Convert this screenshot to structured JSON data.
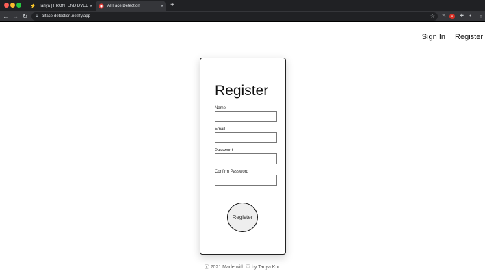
{
  "browser": {
    "tabs": [
      {
        "title": "Tanya | FRONTEND DVELOPER",
        "icon": "bolt-icon",
        "active": false
      },
      {
        "title": "AI Face Detection",
        "icon": "face-detect-icon",
        "active": true
      }
    ],
    "url": "aiface-detection.netlify.app"
  },
  "nav": {
    "sign_in": "Sign In",
    "register": "Register"
  },
  "form": {
    "title": "Register",
    "fields": [
      {
        "label": "Name",
        "value": ""
      },
      {
        "label": "Email",
        "value": ""
      },
      {
        "label": "Password",
        "value": ""
      },
      {
        "label": "Confirm Password",
        "value": ""
      }
    ],
    "submit_label": "Register"
  },
  "footer": {
    "text": "ⓒ 2021 Made with ♡ by Tanya Kuo"
  },
  "colors": {
    "chrome_dark": "#202124",
    "chrome_mid": "#35363a",
    "card_border": "#222222",
    "button_bg": "#eeeeee"
  }
}
